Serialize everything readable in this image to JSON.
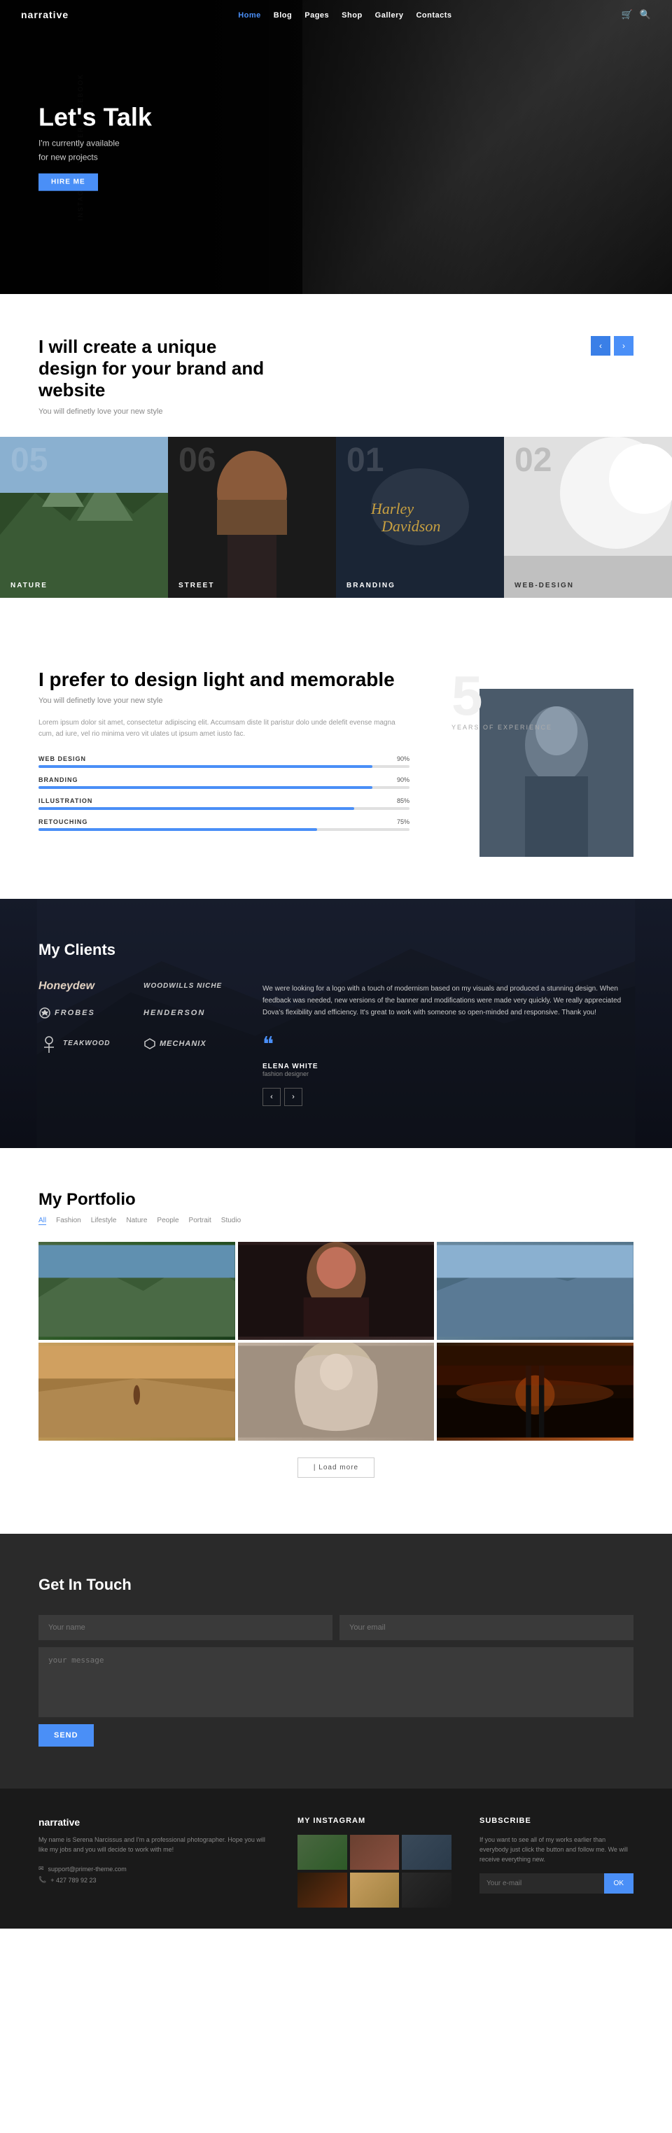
{
  "brand": "narrative",
  "nav": {
    "items": [
      {
        "label": "Home",
        "active": true
      },
      {
        "label": "Blog"
      },
      {
        "label": "Pages"
      },
      {
        "label": "Shop"
      },
      {
        "label": "Gallery"
      },
      {
        "label": "Contacts"
      }
    ]
  },
  "hero": {
    "title": "Let's Talk",
    "subtitle": "I'm currently available",
    "subtitle2": "for new projects",
    "cta": "Hire Me"
  },
  "design_section": {
    "title": "I will create a unique design for your brand and website",
    "subtitle": "You will definetly love your new style",
    "carousel": [
      {
        "num": "05",
        "label": "NATURE",
        "type": "nature"
      },
      {
        "num": "06",
        "label": "STREET",
        "type": "street"
      },
      {
        "num": "01",
        "label": "BRANDING",
        "type": "branding"
      },
      {
        "num": "02",
        "label": "WEB-DESIGN",
        "type": "webdesign"
      }
    ]
  },
  "prefer_section": {
    "title": "I prefer to design light and memorable",
    "subtitle": "You will definetly love your new style",
    "description": "Lorem ipsum dolor sit amet, consectetur adipiscing elit. Accumsam diste lit paristur dolo unde delefit evense magna cum, ad iure, vel rio minima vero vit ulates ut ipsum amet iusto fac.",
    "years": "5",
    "years_label": "YEARS OF EXPERIENCE",
    "skills": [
      {
        "name": "WEB DESIGN",
        "pct": 90
      },
      {
        "name": "BRANDING",
        "pct": 90
      },
      {
        "name": "ILLUSTRATION",
        "pct": 85
      },
      {
        "name": "RETOUCHING",
        "pct": 75
      }
    ]
  },
  "clients_section": {
    "title": "My Clients",
    "logos": [
      {
        "name": "Honeydew",
        "style": "script"
      },
      {
        "name": "WOODWILLS NICHE",
        "style": "normal"
      },
      {
        "name": "FROBES",
        "style": "bold"
      },
      {
        "name": "HENDERSON",
        "style": "serif"
      },
      {
        "name": "TEAKWOOD",
        "style": "normal"
      },
      {
        "name": "MECHANIX",
        "style": "normal"
      }
    ],
    "testimonial": {
      "text": "We were looking for a logo with a touch of modernism based on my visuals and produced a stunning design. When feedback was needed, new versions of the banner and modifications were made very quickly. We really appreciated Dova's flexibility and efficiency. It's great to work with someone so open-minded and responsive. Thank you!",
      "author": "ELENA WHITE",
      "role": "fashion designer"
    }
  },
  "portfolio_section": {
    "title": "My Portfolio",
    "filters": [
      "All",
      "Fashion",
      "Lifestyle",
      "Nature",
      "People",
      "Portrait",
      "Studio"
    ],
    "active_filter": "All",
    "load_more": "| Load more"
  },
  "contact_section": {
    "title": "Get In Touch",
    "name_placeholder": "Your name",
    "email_placeholder": "Your email",
    "message_placeholder": "your message",
    "send_btn": "SEND"
  },
  "footer": {
    "brand": "narrative",
    "description": "My name is Serena Narcissus and I'm a professional photographer. Hope you will like my jobs and you will decide to work with me!",
    "email": "support@primer-theme.com",
    "phone": "+ 427 789 92 23",
    "instagram_title": "MY INSTAGRAM",
    "subscribe_title": "SUBSCRIBE",
    "subscribe_desc": "If you want to see all of my works earlier than everybody just click the button and follow me. We will receive everything new.",
    "subscribe_placeholder": "Your e-mail",
    "subscribe_btn": "OK"
  }
}
